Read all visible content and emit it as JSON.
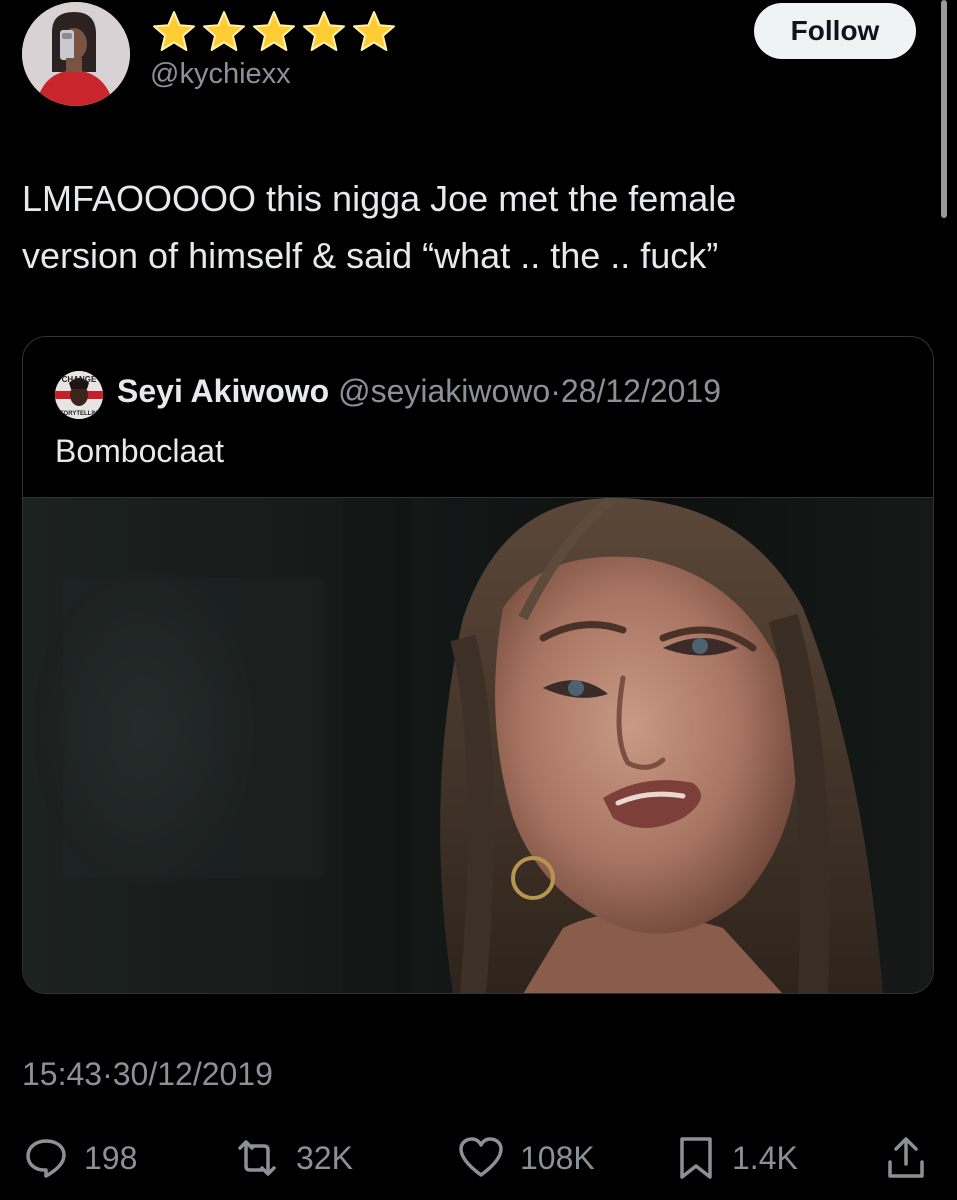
{
  "author": {
    "stars": "★★★★★",
    "handle": "@kychiexx",
    "follow_label": "Follow"
  },
  "tweet": {
    "line1": "LMFAOOOOO this nigga Joe met the female",
    "line2": "version of himself & said “what .. the .. fuck”"
  },
  "quoted": {
    "name": "Seyi Akiwowo",
    "handle": "@seyiakiwowo",
    "separator": "·",
    "date": "28/12/2019",
    "text": "Bomboclaat",
    "avatar_text_top": "CHANGE",
    "avatar_text_bottom": "STORYTELLING",
    "image_icon": "photo-of-crying-woman"
  },
  "meta": {
    "time": "15:43",
    "separator": "·",
    "date": "30/12/2019"
  },
  "actions": {
    "replies": "198",
    "retweets": "32K",
    "likes": "108K",
    "bookmarks": "1.4K"
  },
  "colors": {
    "background": "#000000",
    "text": "#e7e9ea",
    "muted": "#8b9197",
    "star": "#ffcc33",
    "follow_bg": "#eff3f4",
    "border": "#2f3336"
  },
  "icons": {
    "reply": "speech-bubble-icon",
    "retweet": "retweet-icon",
    "like": "heart-icon",
    "bookmark": "bookmark-icon",
    "share": "share-icon"
  }
}
